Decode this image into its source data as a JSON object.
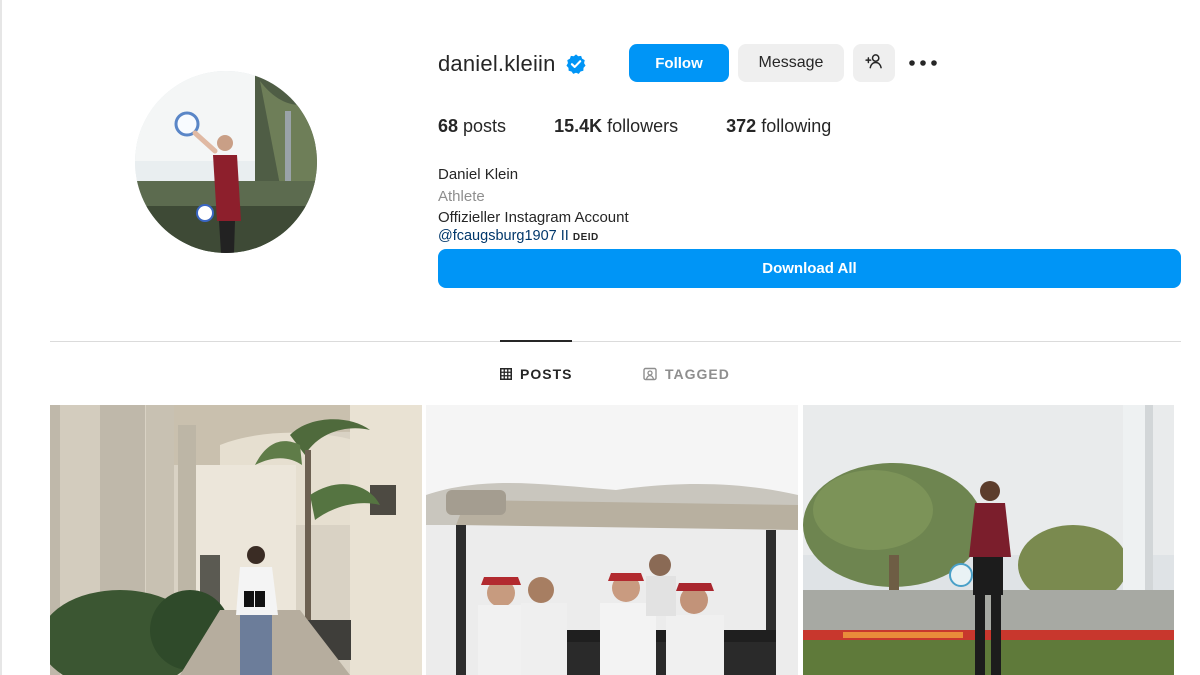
{
  "profile": {
    "username": "daniel.kleiin",
    "verified_icon": "verified-badge-icon",
    "follow_label": "Follow",
    "message_label": "Message",
    "add_user_icon": "add-user-icon",
    "more_icon": "more-options-icon",
    "stats": {
      "posts_count": "68",
      "posts_label": "posts",
      "followers_count": "15.4K",
      "followers_label": "followers",
      "following_count": "372",
      "following_label": "following"
    },
    "bio": {
      "name": "Daniel Klein",
      "category": "Athlete",
      "description": "Offizieller Instagram Account",
      "mention": "@fcaugsburg1907",
      "mention_suffix": "II",
      "mention_small": "DEID"
    },
    "download_label": "Download All"
  },
  "tabs": [
    {
      "label": "POSTS",
      "icon": "grid-icon",
      "active": true
    },
    {
      "label": "TAGGED",
      "icon": "tagged-icon",
      "active": false
    }
  ],
  "colors": {
    "accent": "#0095f6",
    "secondary_button": "#efefef",
    "text": "#262626",
    "muted": "#8e8e8e",
    "link": "#00376b"
  },
  "posts": [
    {
      "name": "post-colonnade"
    },
    {
      "name": "post-golf-cart"
    },
    {
      "name": "post-training-field"
    }
  ]
}
